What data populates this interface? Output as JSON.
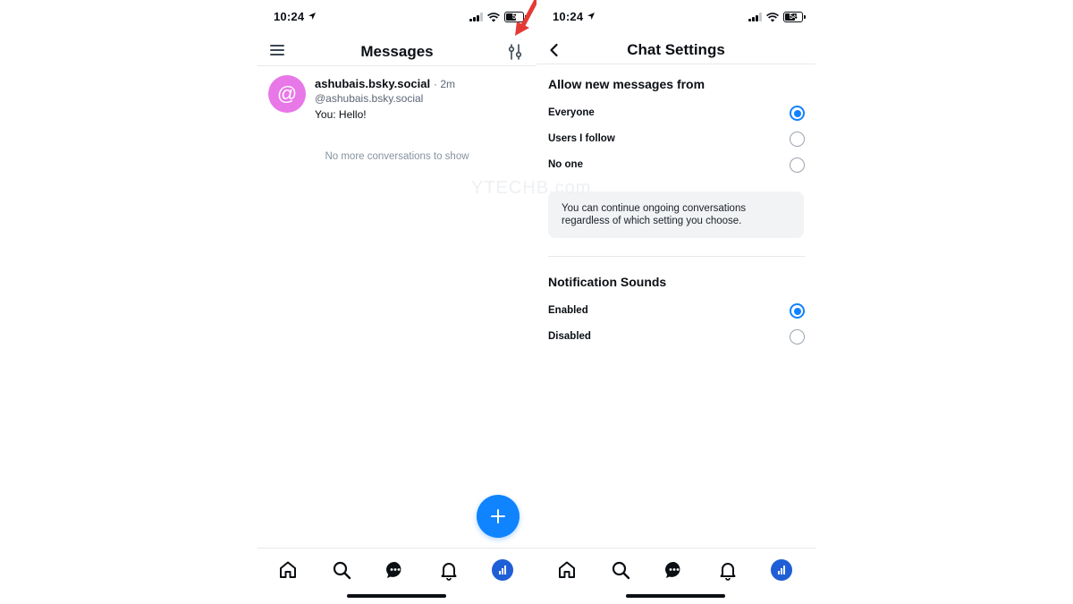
{
  "colors": {
    "accent": "#1083fe",
    "avatar_bg": "#e877e8",
    "annotation": "#e53935"
  },
  "status_bar": {
    "time": "10:24",
    "battery_left": "5",
    "battery_right": "54"
  },
  "messages_screen": {
    "title": "Messages",
    "conversation": {
      "avatar_symbol": "@",
      "name": "ashubais.bsky.social",
      "time": "· 2m",
      "handle": "@ashubais.bsky.social",
      "last_message": "You: Hello!"
    },
    "empty_text": "No more conversations to show",
    "fab_icon": "plus-icon"
  },
  "settings_screen": {
    "title": "Chat Settings",
    "allow_section": {
      "title": "Allow new messages from",
      "options": [
        {
          "label": "Everyone",
          "selected": true
        },
        {
          "label": "Users I follow",
          "selected": false
        },
        {
          "label": "No one",
          "selected": false
        }
      ],
      "info": "You can continue ongoing conversations regardless of which setting you choose."
    },
    "sound_section": {
      "title": "Notification Sounds",
      "options": [
        {
          "label": "Enabled",
          "selected": true
        },
        {
          "label": "Disabled",
          "selected": false
        }
      ]
    }
  },
  "bottom_nav": [
    "home-icon",
    "search-icon",
    "chat-icon",
    "bell-icon",
    "profile-avatar"
  ],
  "watermark": "YTECHB.com"
}
